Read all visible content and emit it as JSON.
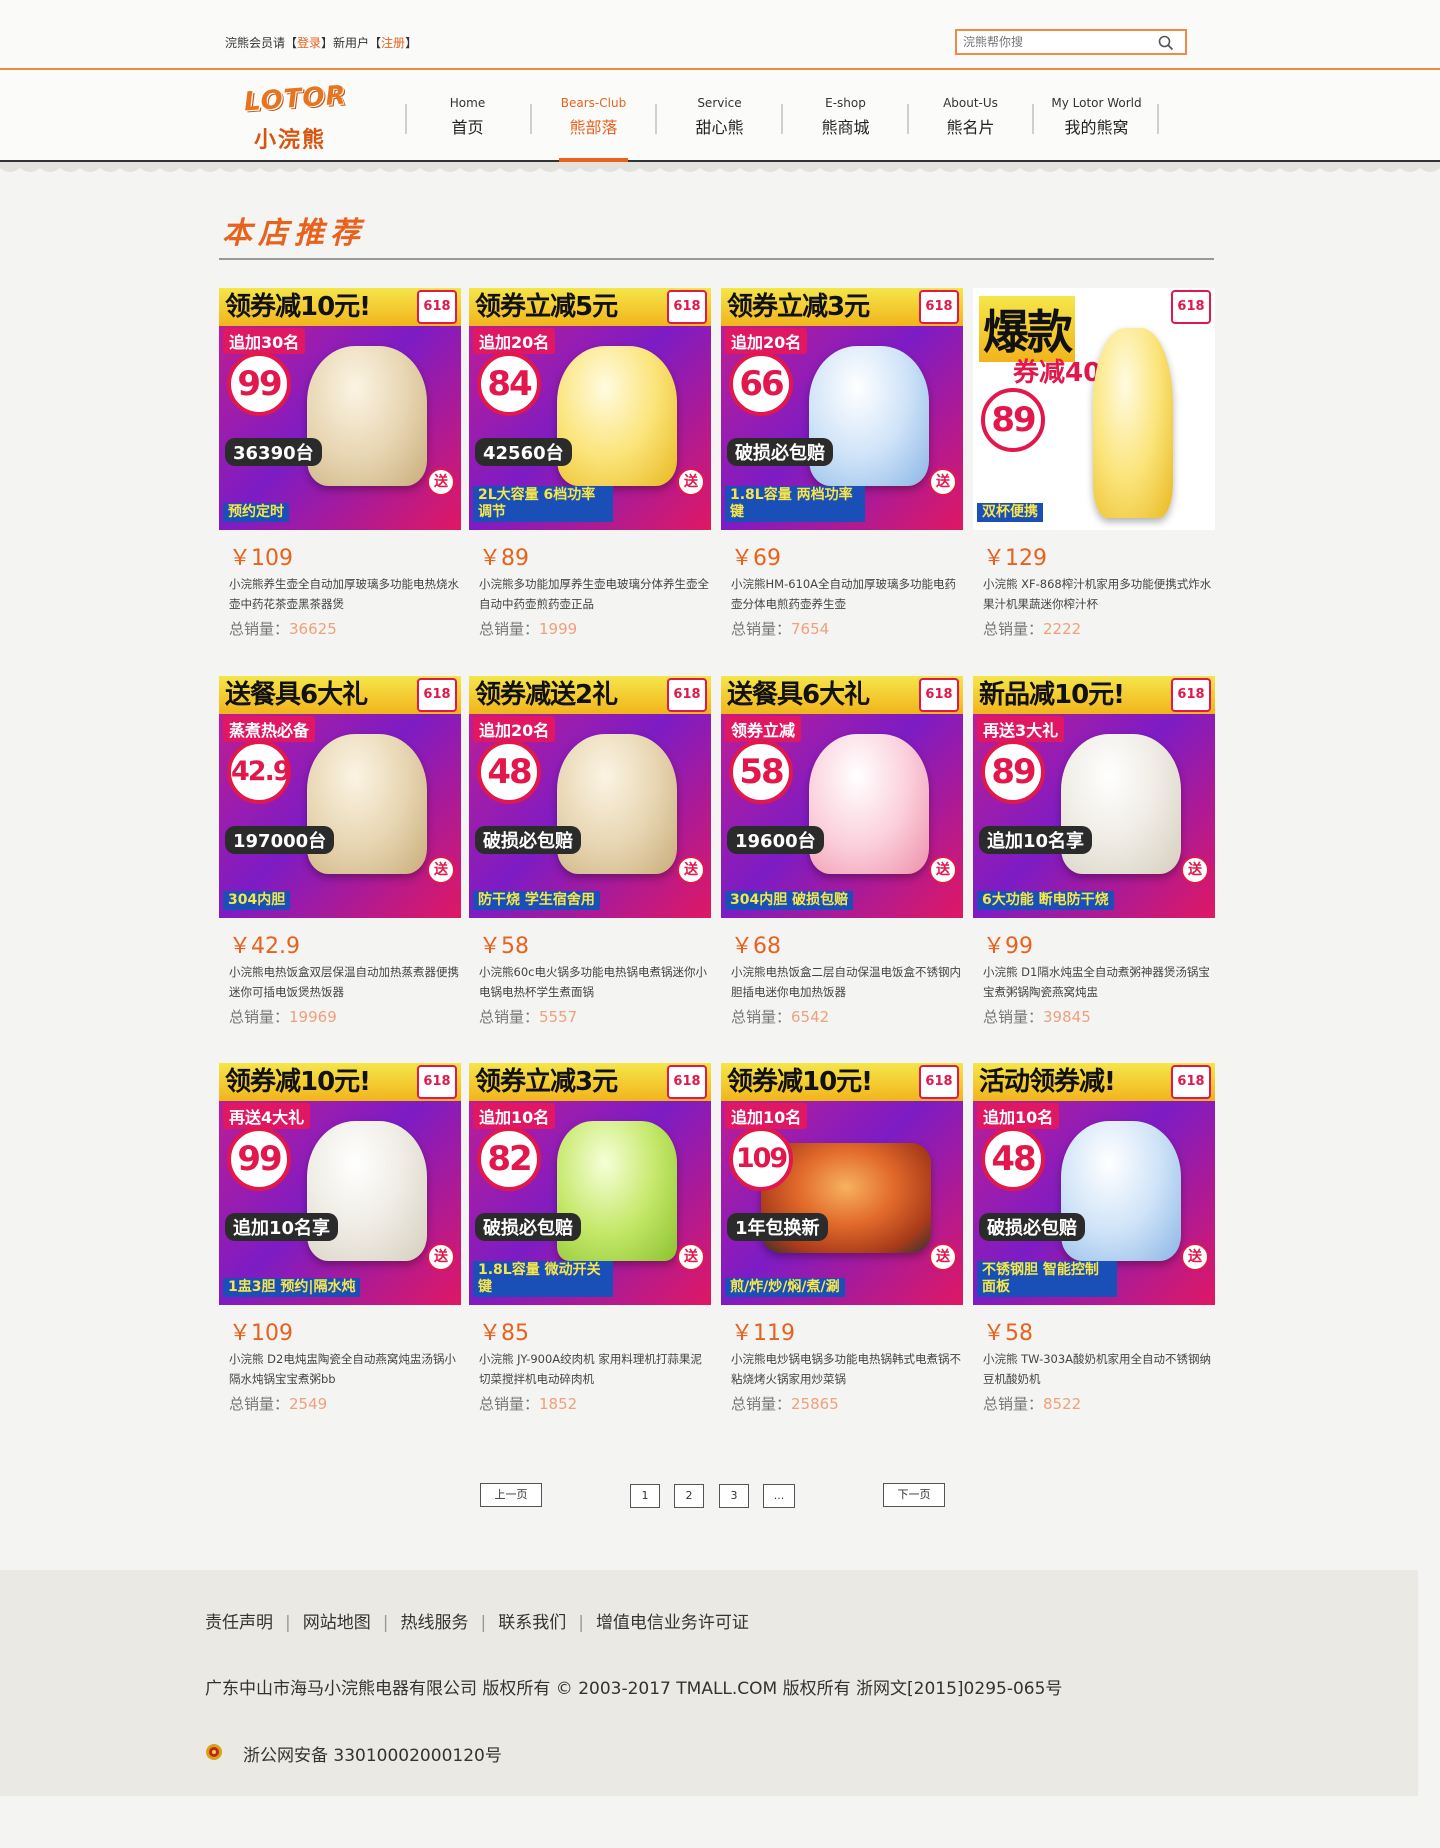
{
  "topbar": {
    "member_prefix": "浣熊会员请【",
    "login": "登录",
    "middle": "】新用户【",
    "register": "注册",
    "suffix": "】",
    "search_placeholder": "浣熊帮你搜"
  },
  "logo": {
    "en": "LOTOR",
    "cn": "小浣熊"
  },
  "nav": [
    {
      "en": "Home",
      "cn": "首页"
    },
    {
      "en": "Bears-Club",
      "cn": "熊部落",
      "active": true
    },
    {
      "en": "Service",
      "cn": "甜心熊"
    },
    {
      "en": "E-shop",
      "cn": "熊商城"
    },
    {
      "en": "About-Us",
      "cn": "熊名片"
    },
    {
      "en": "My Lotor World",
      "cn": "我的熊窝"
    }
  ],
  "section_title": "本店推荐",
  "sales_label": "总销量：",
  "products": [
    {
      "banner": "领券减10元!",
      "sub": "追加30名",
      "circle": "99",
      "sold": "36390台",
      "tag": "预约定时",
      "price": "￥109",
      "desc": "小浣熊养生壶全自动加厚玻璃多功能电热烧水壶中药花茶壶黑茶器煲",
      "sales": "36625",
      "color": "gold"
    },
    {
      "banner": "领券立减5元",
      "sub": "追加20名",
      "circle": "84",
      "sold": "42560台",
      "tag": "2L大容量 6档功率调节",
      "price": "￥89",
      "desc": "小浣熊多功能加厚养生壶电玻璃分体养生壶全自动中药壶煎药壶正品",
      "sales": "1999",
      "color": "yellow"
    },
    {
      "banner": "领券立减3元",
      "sub": "追加20名",
      "circle": "66",
      "sold": "破损必包赔",
      "tag": "1.8L容量 两档功率键",
      "price": "￥69",
      "desc": "小浣熊HM-610A全自动加厚玻璃多功能电药壶分体电煎药壶养生壶",
      "sales": "7654",
      "color": "blue"
    },
    {
      "banner": "爆款",
      "sub": "券减40",
      "circle": "89",
      "sold": "",
      "tag": "双杯便携",
      "price": "￥129",
      "desc": "小浣熊 XF-868榨汁机家用多功能便携式炸水果汁机果蔬迷你榨汁杯",
      "sales": "2222",
      "color": "yellow",
      "white": true
    },
    {
      "banner": "送餐具6大礼",
      "sub": "蒸煮热必备",
      "circle": "42.9",
      "sold": "197000台",
      "tag": "304内胆",
      "price": "￥42.9",
      "desc": "小浣熊电热饭盒双层保温自动加热蒸煮器便携迷你可插电饭煲热饭器",
      "sales": "19969",
      "color": "gold"
    },
    {
      "banner": "领券减送2礼",
      "sub": "追加20名",
      "circle": "48",
      "sold": "破损必包赔",
      "tag": "防干烧 学生宿舍用",
      "price": "￥58",
      "desc": "小浣熊60c电火锅多功能电热锅电煮锅迷你小电锅电热杯学生煮面锅",
      "sales": "5557",
      "color": "gold"
    },
    {
      "banner": "送餐具6大礼",
      "sub": "领券立减",
      "circle": "58",
      "sold": "19600台",
      "tag": "304内胆 破损包赔",
      "price": "￥68",
      "desc": "小浣熊电热饭盒二层自动保温电饭盒不锈钢内胆插电迷你电加热饭器",
      "sales": "6542",
      "color": "pink"
    },
    {
      "banner": "新品减10元!",
      "sub": "再送3大礼",
      "circle": "89",
      "sold": "追加10名享",
      "tag": "6大功能 断电防干烧",
      "price": "￥99",
      "desc": "小浣熊 D1隔水炖盅全自动煮粥神器煲汤锅宝宝煮粥锅陶瓷燕窝炖盅",
      "sales": "39845",
      "color": ""
    },
    {
      "banner": "领券减10元!",
      "sub": "再送4大礼",
      "circle": "99",
      "sold": "追加10名享",
      "tag": "1盅3胆 预约|隔水炖",
      "price": "￥109",
      "desc": "小浣熊 D2电炖盅陶瓷全自动燕窝炖盅汤锅小隔水炖锅宝宝煮粥bb",
      "sales": "2549",
      "color": ""
    },
    {
      "banner": "领券立减3元",
      "sub": "追加10名",
      "circle": "82",
      "sold": "破损必包赔",
      "tag": "1.8L容量 微动开关键",
      "price": "￥85",
      "desc": "小浣熊 JY-900A绞肉机 家用料理机打蒜果泥切菜搅拌机电动碎肉机",
      "sales": "1852",
      "color": "green"
    },
    {
      "banner": "领券减10元!",
      "sub": "追加10名",
      "circle": "109",
      "sold": "1年包换新",
      "tag": "煎/炸/炒/焖/煮/涮",
      "price": "￥119",
      "desc": "小浣熊电炒锅电锅多功能电热锅韩式电煮锅不粘烧烤火锅家用炒菜锅",
      "sales": "25865",
      "color": "pot"
    },
    {
      "banner": "活动领券减!",
      "sub": "追加10名",
      "circle": "48",
      "sold": "破损必包赔",
      "tag": "不锈钢胆 智能控制面板",
      "price": "￥58",
      "desc": "小浣熊 TW-303A酸奶机家用全自动不锈钢纳豆机酸奶机",
      "sales": "8522",
      "color": "blue"
    }
  ],
  "pagination": {
    "prev": "上一页",
    "pages": [
      "1",
      "2",
      "3",
      "..."
    ],
    "next": "下一页"
  },
  "footer": {
    "links": [
      "责任声明",
      "网站地图",
      "热线服务",
      "联系我们",
      "增值电信业务许可证"
    ],
    "copyright": "广东中山市海马小浣熊电器有限公司 版权所有  © 2003-2017 TMALL.COM 版权所有  浙网文[2015]0295-065号",
    "police": "浙公网安备 33010002000120号"
  },
  "colors": {
    "accent": "#e8621d",
    "sales_number": "#f0a07a",
    "footer_bg": "#ebe9e3"
  }
}
